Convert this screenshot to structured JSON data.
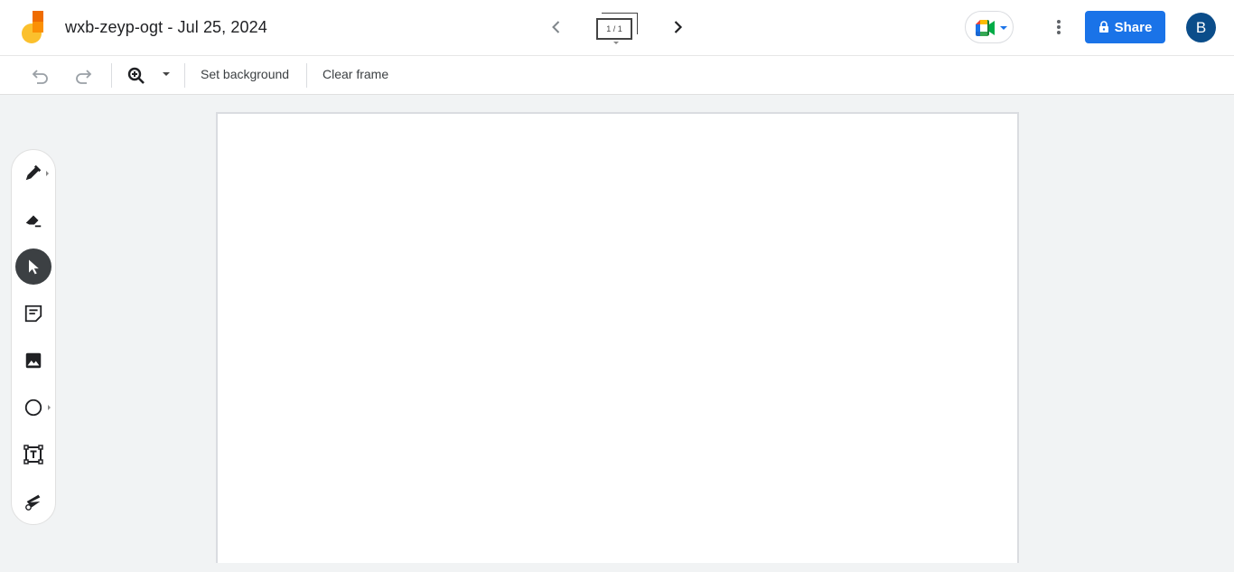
{
  "header": {
    "title": "wxb-zeyp-ogt - Jul 25, 2024",
    "frame_indicator": "1 / 1",
    "share_label": "Share",
    "avatar_initial": "B",
    "icons": {
      "logo": "jamboard-logo",
      "prev": "chevron-left-icon",
      "next": "chevron-right-icon",
      "meet": "google-meet-icon",
      "more": "more-vert-icon",
      "lock": "lock-icon"
    }
  },
  "toolbar": {
    "undo": "undo-icon",
    "redo": "redo-icon",
    "zoom": "zoom-in-icon",
    "set_background_label": "Set background",
    "clear_frame_label": "Clear frame"
  },
  "tools": [
    {
      "name": "pen",
      "icon": "pen-icon",
      "has_submenu": true
    },
    {
      "name": "eraser",
      "icon": "eraser-icon",
      "has_submenu": false
    },
    {
      "name": "select",
      "icon": "pointer-icon",
      "has_submenu": false,
      "active": true
    },
    {
      "name": "sticky-note",
      "icon": "sticky-note-icon",
      "has_submenu": false
    },
    {
      "name": "image",
      "icon": "image-icon",
      "has_submenu": false
    },
    {
      "name": "shape",
      "icon": "circle-icon",
      "has_submenu": true
    },
    {
      "name": "text-box",
      "icon": "text-box-icon",
      "has_submenu": false
    },
    {
      "name": "laser",
      "icon": "laser-icon",
      "has_submenu": false
    }
  ],
  "colors": {
    "accent": "#1a73e8",
    "avatar_bg": "#0b4d8a",
    "background": "#f1f3f4",
    "active_tool": "#3c4043"
  }
}
